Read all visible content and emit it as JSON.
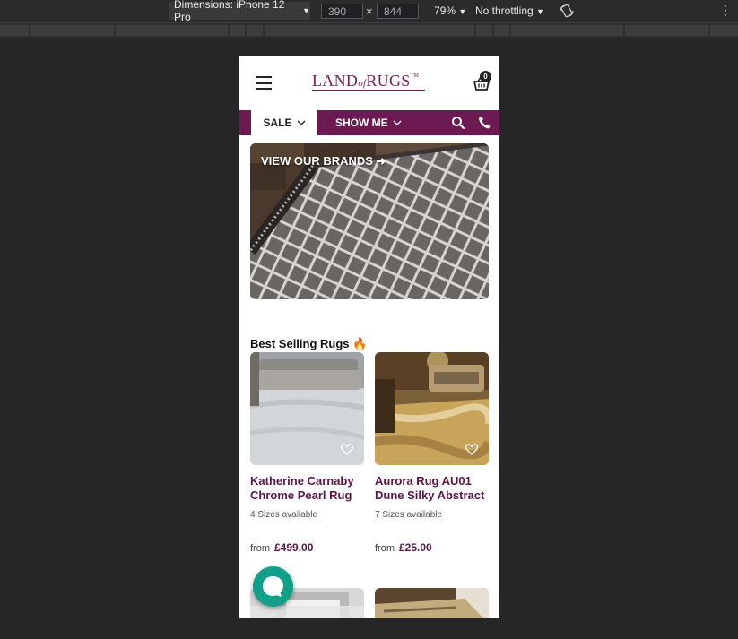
{
  "devtools": {
    "dimensions_label": "Dimensions: iPhone 12 Pro",
    "width_value": "390",
    "height_value": "844",
    "zoom": "79%",
    "throttling": "No throttling"
  },
  "header": {
    "logo_main": "LAND",
    "logo_of": "of",
    "logo_end": "RUGS",
    "logo_tm": "TM",
    "basket_count": "0"
  },
  "nav": {
    "sale_label": "SALE",
    "show_me_label": "SHOW ME"
  },
  "banner": {
    "text": "VIEW OUR BRANDS ➜"
  },
  "best_selling": {
    "title": "Best Selling Rugs 🔥",
    "products": [
      {
        "name": "Katherine Carnaby Chrome Pearl Rug",
        "sizes": "4 Sizes available",
        "from_label": "from",
        "price": "£499.00"
      },
      {
        "name": "Aurora Rug AU01 Dune Silky Abstract",
        "sizes": "7 Sizes available",
        "from_label": "from",
        "price": "£25.00"
      }
    ]
  },
  "colors": {
    "brand": "#6d1a52",
    "product_text": "#5c1546",
    "chat": "#12a08a"
  }
}
